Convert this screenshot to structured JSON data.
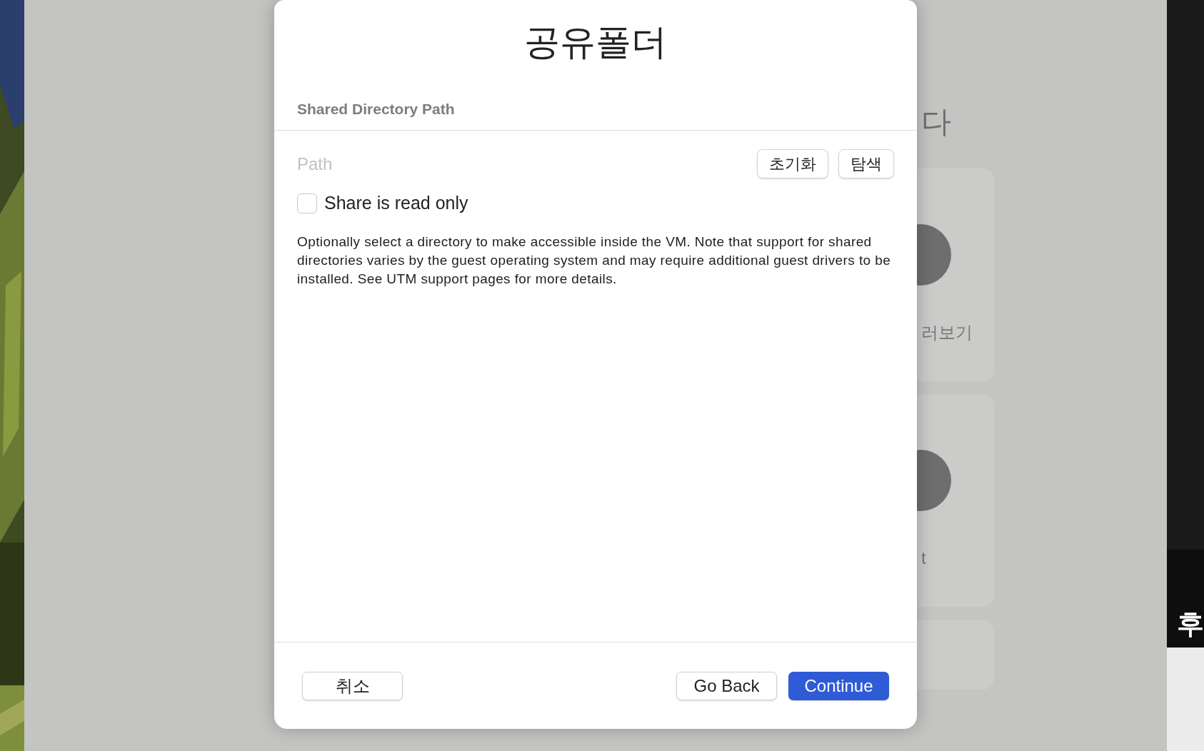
{
  "dialog": {
    "title": "공유폴더",
    "section_header": "Shared Directory Path",
    "path_field": {
      "placeholder": "Path"
    },
    "path_buttons": [
      {
        "label": "초기화"
      },
      {
        "label": "탐색"
      }
    ],
    "read_only": {
      "label": "Share is read only",
      "checked": false
    },
    "description": "Optionally select a directory to make accessible inside the VM. Note that support for shared directories varies by the guest operating system and may require additional guest drivers to be installed. See UTM support pages for more details.",
    "footer_buttons": [
      {
        "label": "취소",
        "kind": "default"
      },
      {
        "label": "Go Back",
        "kind": "default"
      },
      {
        "label": "Continue",
        "kind": "primary"
      }
    ]
  },
  "background": {
    "heading": "다",
    "cards": [
      {
        "label": "러보기"
      },
      {
        "label": "t"
      }
    ]
  },
  "overlay_caption": "후"
}
